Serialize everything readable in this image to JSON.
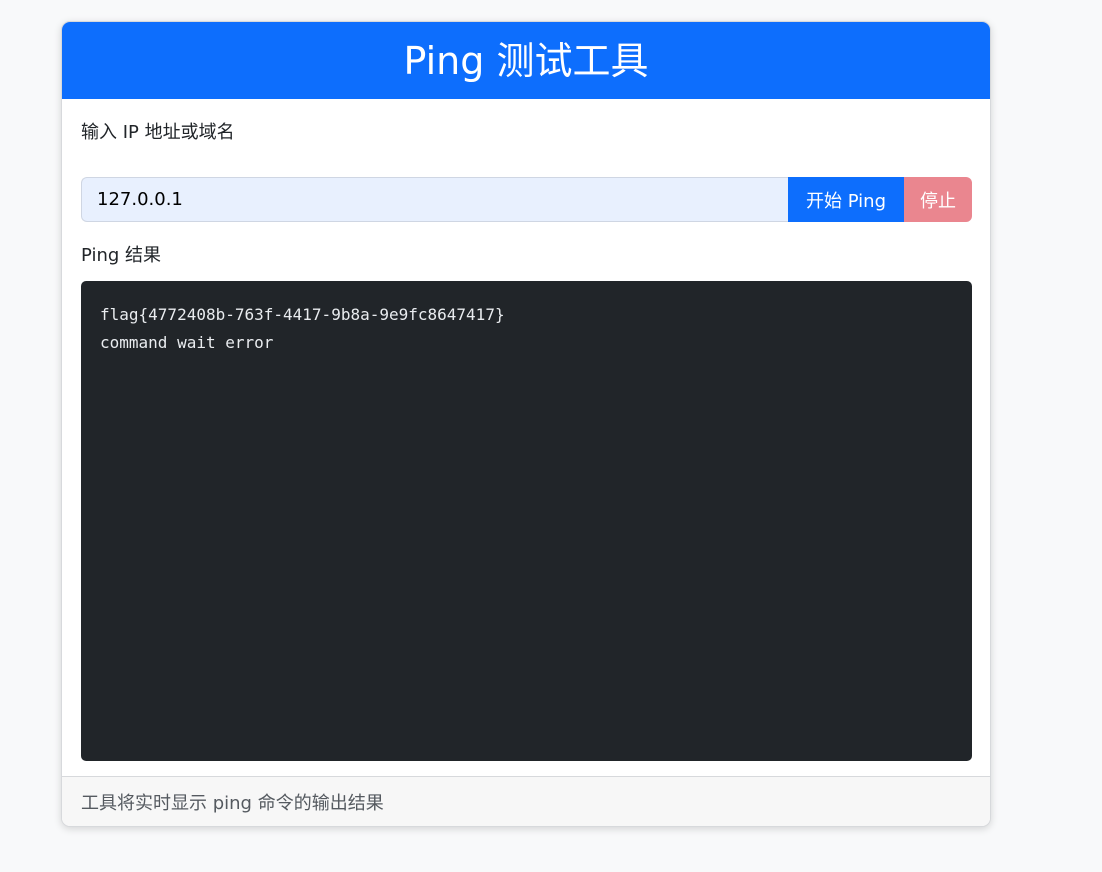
{
  "header": {
    "title": "Ping 测试工具"
  },
  "form": {
    "ip_label": "输入 IP 地址或域名",
    "ip_value": "127.0.0.1",
    "start_label": "开始 Ping",
    "stop_label": "停止"
  },
  "result": {
    "label": "Ping 结果",
    "lines": [
      "flag{4772408b-763f-4417-9b8a-9e9fc8647417}",
      "command wait error"
    ]
  },
  "footer": {
    "note": "工具将实时显示 ping 命令的输出结果"
  },
  "colors": {
    "primary": "#0d6efd",
    "stop": "#ea868f",
    "terminal_bg": "#212529",
    "input_bg": "#e8f0fe"
  }
}
